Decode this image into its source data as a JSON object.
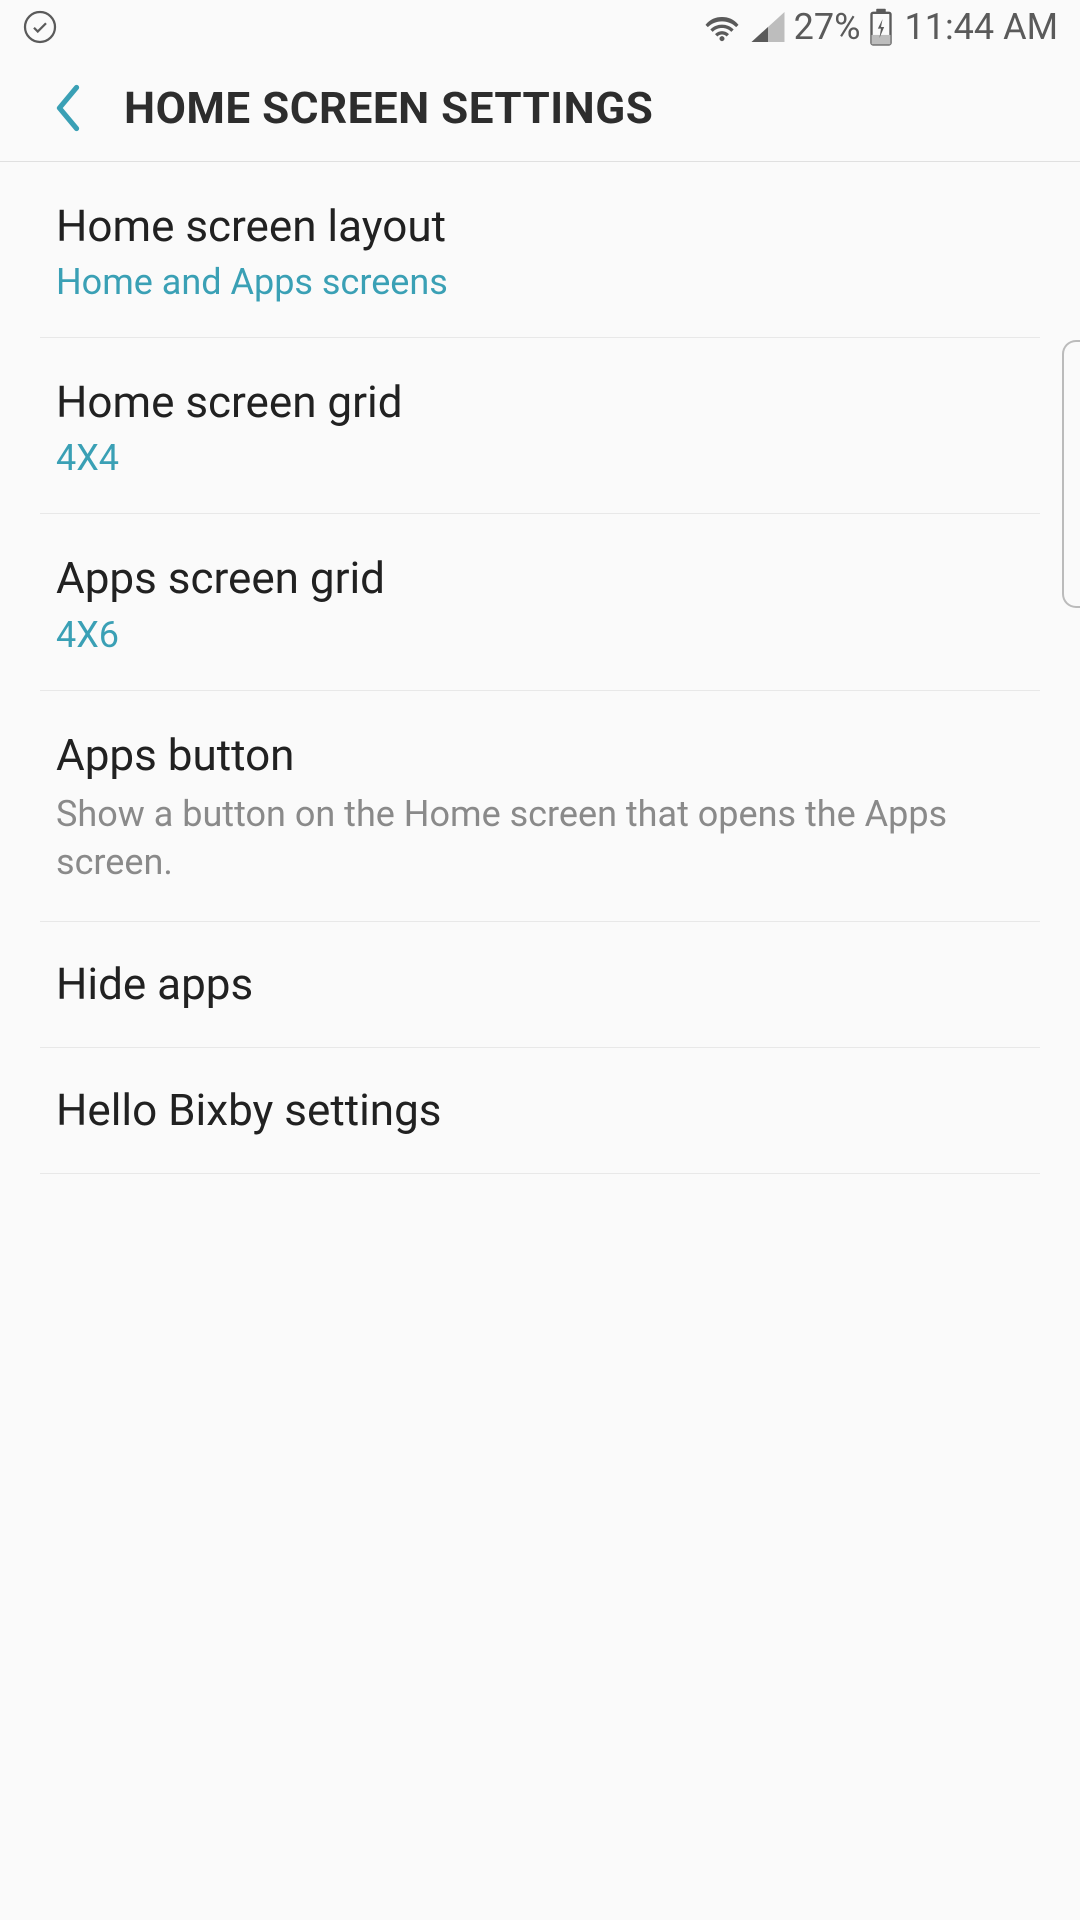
{
  "status_bar": {
    "battery_pct": "27%",
    "time": "11:44 AM"
  },
  "header": {
    "title": "HOME SCREEN SETTINGS"
  },
  "settings": {
    "items": [
      {
        "title": "Home screen layout",
        "value": "Home and Apps screens",
        "description": ""
      },
      {
        "title": "Home screen grid",
        "value": "4X4",
        "description": ""
      },
      {
        "title": "Apps screen grid",
        "value": "4X6",
        "description": ""
      },
      {
        "title": "Apps button",
        "value": "",
        "description": "Show a button on the Home screen that opens the Apps screen."
      },
      {
        "title": "Hide apps",
        "value": "",
        "description": ""
      },
      {
        "title": "Hello Bixby settings",
        "value": "",
        "description": ""
      }
    ]
  }
}
